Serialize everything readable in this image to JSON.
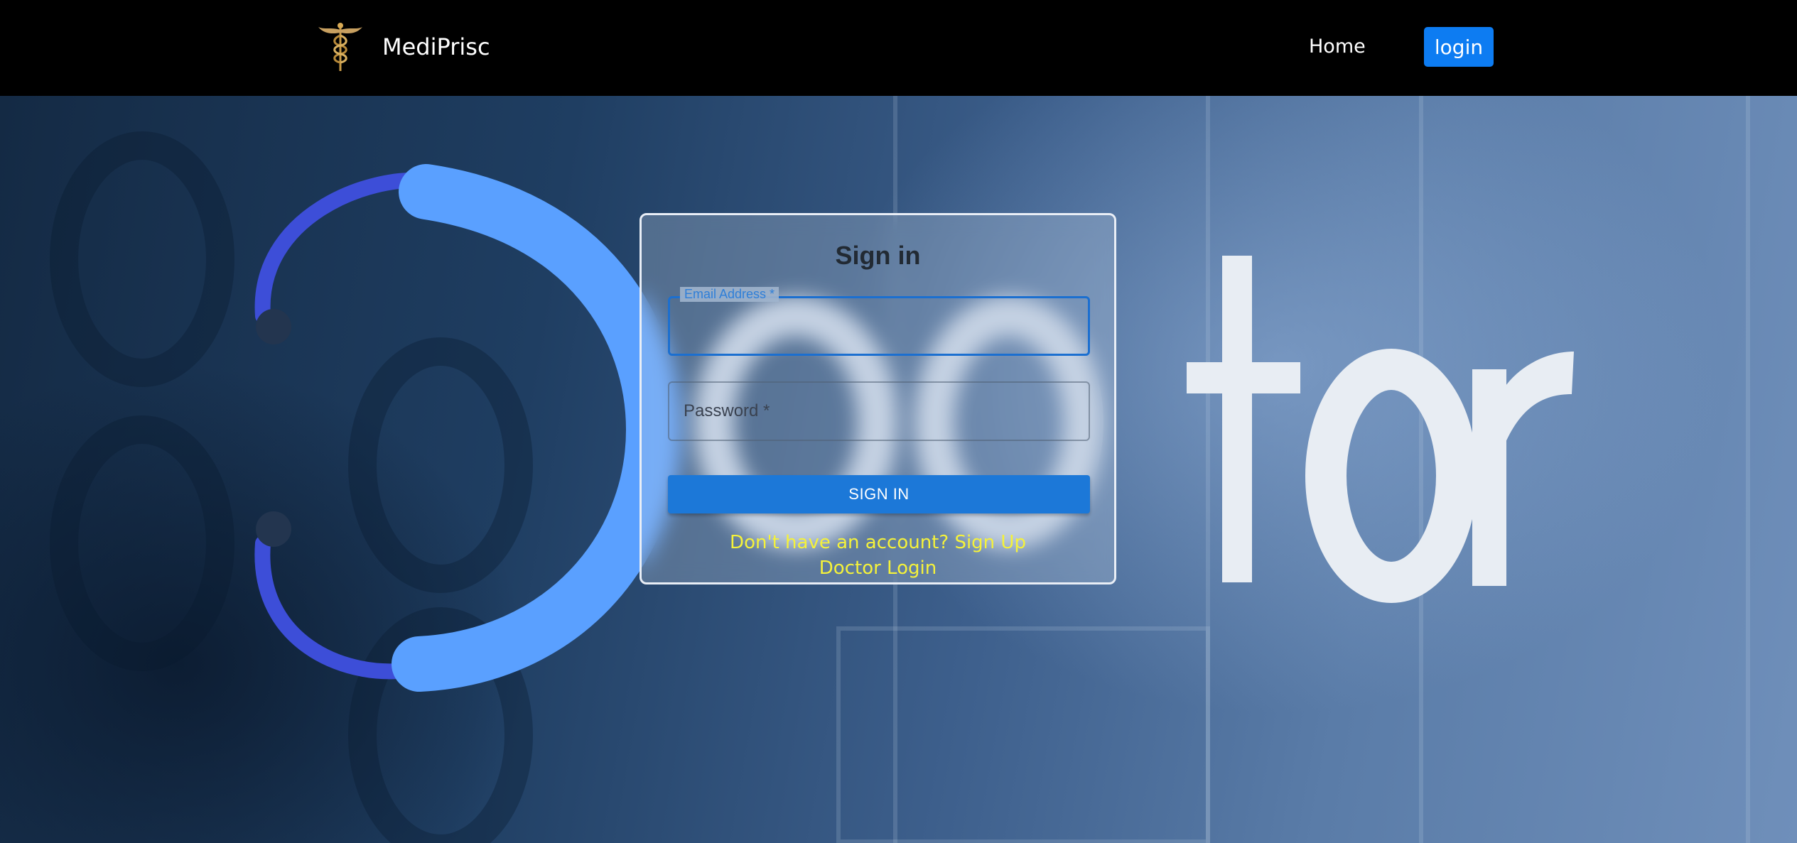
{
  "navbar": {
    "brand_name": "MediPrisc",
    "logo_icon": "caduceus-icon",
    "home_label": "Home",
    "login_label": "login",
    "background_color": "#000000",
    "login_color": "#0d7cf2"
  },
  "hero": {
    "background_text": "Doctor"
  },
  "signin": {
    "title": "Sign in",
    "email_label": "Email Address *",
    "email_value": "",
    "password_placeholder": "Password *",
    "password_value": "",
    "button_label": "SIGN IN",
    "signup_link": "Don't have an account? Sign Up",
    "doctor_login_link": "Doctor Login",
    "accent_color": "#1c78d8",
    "link_color": "#f5f23a"
  }
}
